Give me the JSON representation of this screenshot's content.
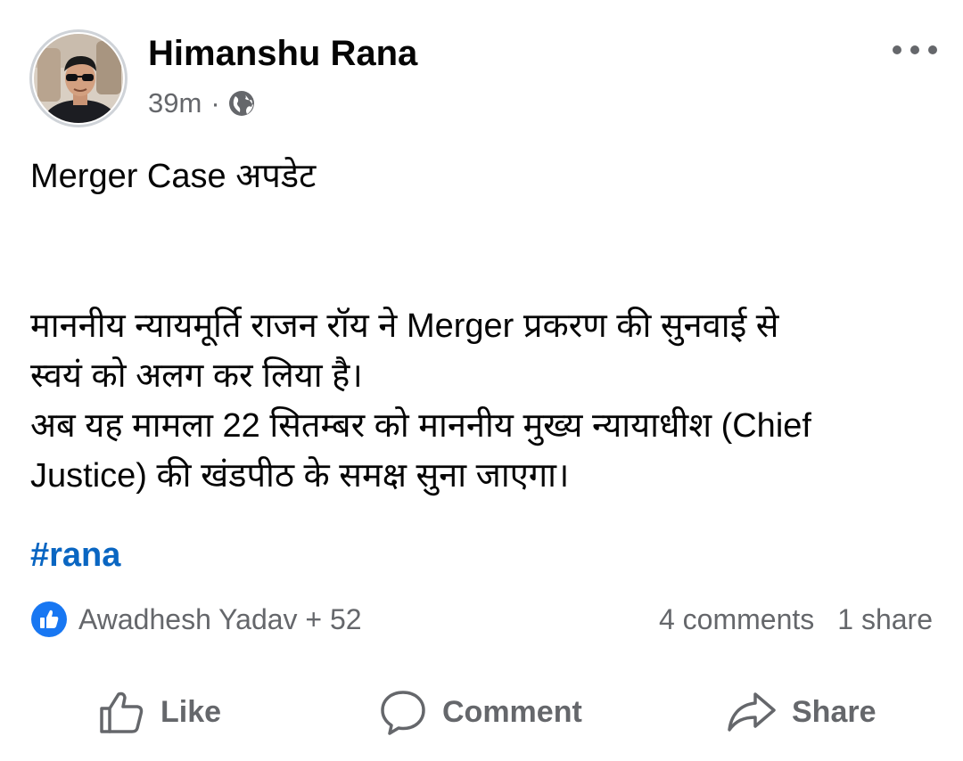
{
  "post": {
    "author": "Himanshu Rana",
    "time": "39m",
    "separator": "·",
    "audience_icon": "globe-icon",
    "title_line": "Merger Case अपडेट",
    "body_line1": "माननीय न्यायमूर्ति राजन रॉय ने Merger प्रकरण की सुनवाई से",
    "body_line2": "स्वयं को अलग कर लिया है।",
    "body_line3": "अब यह मामला 22 सितम्बर को माननीय मुख्य न्यायाधीश (Chief",
    "body_line4": "Justice) की खंडपीठ के समक्ष सुना जाएगा।",
    "hashtag": "#rana"
  },
  "engagement": {
    "reaction_icon": "thumbs-up-icon",
    "reactors": "Awadhesh Yadav + 52",
    "comments": "4 comments",
    "shares": "1 share"
  },
  "actions": {
    "like_label": "Like",
    "comment_label": "Comment",
    "share_label": "Share"
  },
  "colors": {
    "hashtag": "#0a66c2",
    "reaction_badge": "#1877f2",
    "secondary_text": "#65676b",
    "primary_text": "#050505"
  }
}
